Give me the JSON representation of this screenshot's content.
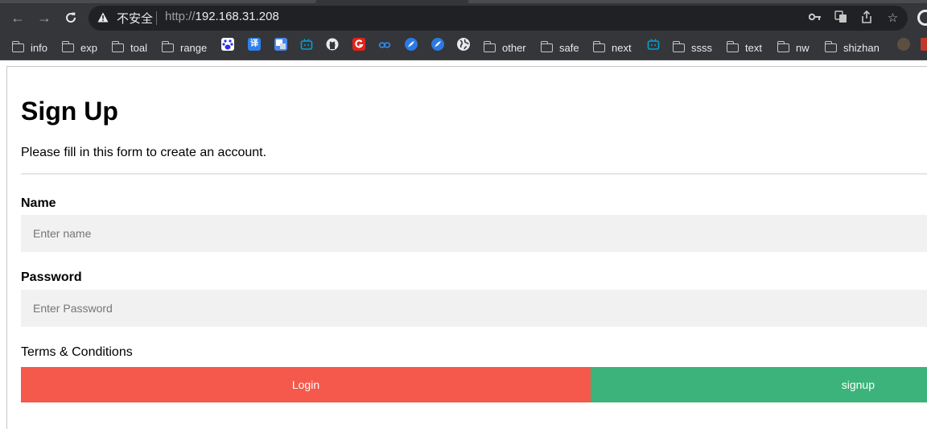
{
  "browser": {
    "address": {
      "security_label": "不安全",
      "url_scheme": "http://",
      "url_host": "192.168.31.208"
    },
    "bookmarks": [
      {
        "label": "info",
        "icon": "folder-icon"
      },
      {
        "label": "exp",
        "icon": "folder-icon"
      },
      {
        "label": "toal",
        "icon": "folder-icon"
      },
      {
        "label": "range",
        "icon": "folder-icon"
      },
      {
        "label": "other",
        "icon": "folder-icon"
      },
      {
        "label": "safe",
        "icon": "folder-icon"
      },
      {
        "label": "next",
        "icon": "folder-icon"
      },
      {
        "label": "ssss",
        "icon": "folder-icon"
      },
      {
        "label": "text",
        "icon": "folder-icon"
      },
      {
        "label": "nw",
        "icon": "folder-icon"
      },
      {
        "label": "shizhan",
        "icon": "folder-icon"
      }
    ],
    "bookmark_icons": [
      "baidu-icon",
      "translate-icon",
      "google-translate-icon",
      "bilibili-icon",
      "github-icon",
      "g-icon",
      "cloud-icon",
      "feather-icon",
      "feather-icon",
      "globe-icon",
      "bilibili-icon"
    ],
    "icons": {
      "yi": "译"
    }
  },
  "form": {
    "title": "Sign Up",
    "subtitle": "Please fill in this form to create an account.",
    "name_label": "Name",
    "name_placeholder": "Enter name",
    "name_value": "",
    "password_label": "Password",
    "password_placeholder": "Enter Password",
    "password_value": "",
    "terms": "Terms & Conditions",
    "login_label": "Login",
    "signup_label": "signup"
  },
  "colors": {
    "login": "#f4594b",
    "signup": "#3bb37a",
    "input_bg": "#f1f1f1",
    "chrome_bg": "#35363a"
  }
}
